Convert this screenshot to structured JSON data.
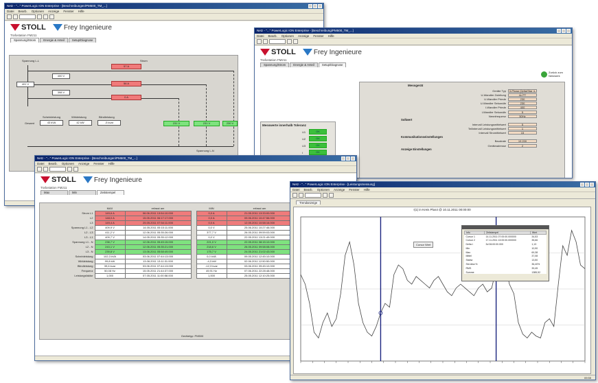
{
  "windows": {
    "w1": {
      "title": "Netz - \"...\" PowerLogic ION Enterprise - [Beschreibungen/PM500_TM_...]",
      "menu": [
        "Datei",
        "Bearb.",
        "Optionen",
        "Anzeige",
        "Fenster",
        "Hilfe"
      ]
    },
    "w2": {
      "title": "Netz - \"...\" PowerLogic ION Enterprise - [Beschreibung/PM500_TM_...]",
      "menu": [
        "Datei",
        "Bearb.",
        "Optionen",
        "Anzeige",
        "Fenster",
        "Hilfe"
      ]
    },
    "w3": {
      "title": "Netz - \"...\" PowerLogic ION Enterprise - [Beschreibungen/PM500_TM_...]",
      "menu": [
        "Datei",
        "Bearb.",
        "Optionen",
        "Anzeige",
        "Fenster",
        "Hilfe"
      ]
    },
    "w4": {
      "title": "Netz - \"...\" PowerLogic ION Enterprise - [Leistungsmessung]",
      "menu": [
        "Datei",
        "Bearb.",
        "Optionen",
        "Anzeige",
        "Fenster",
        "Hilfe"
      ]
    }
  },
  "brand": {
    "stoll": "STOLL",
    "frey": "Frey Ingenieure"
  },
  "w1": {
    "crumb": "Trafostation FM211",
    "tabs": [
      "Spannung/Strom",
      "Energie & Anteil",
      "Setup/Diagnose"
    ],
    "labels": {
      "spannung": "Spannung L-L",
      "strom": "Strom",
      "s1": "Spannung L-N"
    },
    "values": {
      "u1": "400 V",
      "u2": "401 V",
      "u3": "398 V",
      "i1": "57 A",
      "i2": "56 A",
      "i3": "0 A",
      "ln1": "231 V",
      "ln2": "231 V",
      "ln3": "230 V"
    },
    "bottom": {
      "a": "Scheinleistung",
      "b": "Wirkleistung",
      "c": "Blindleistung",
      "va": "43 kVA",
      "vb": "42 kW",
      "vc": "-5 kvar",
      "label": "Gesamt"
    },
    "status": "09:55"
  },
  "w2": {
    "crumb": "Trafostation FM211",
    "tabs": [
      "Spannung/Strom",
      "Energie & Anteil",
      "Setup/Diagnose"
    ],
    "link": "Zurück zum Netzwerk",
    "section": "Messgerät",
    "rows": [
      {
        "k": "Geräte Typ",
        "v": "3-Phase Delta/Star 4-Wire"
      },
      {
        "k": "U-Wandler Zuleitung",
        "v": "4x PT"
      },
      {
        "k": "U-Wandler Primär",
        "v": "230"
      },
      {
        "k": "U-Wandler Sekundär",
        "v": "230"
      },
      {
        "k": "I-Wandler Primär",
        "v": "400"
      },
      {
        "k": "I-Wandler Sekundär",
        "v": "5"
      },
      {
        "k": "Nennfrequenz",
        "v": "50Hz"
      }
    ],
    "sub1": "Sollwert",
    "rows2": [
      {
        "k": "Intervall Leistungsmittelwert",
        "v": "5"
      },
      {
        "k": "Teilintervall Leistungsmittelwert",
        "v": "1"
      },
      {
        "k": "Intervall Stromittelwert",
        "v": "15"
      }
    ],
    "sub2": "Kommunikationseinstellungen",
    "rows3": [
      {
        "k": "Baudrate",
        "v": "19 200"
      },
      {
        "k": "Geräteadresse",
        "v": "2"
      }
    ],
    "sub3": "Anzeige Einstellungen",
    "toleranz_title": "Messwerte innerhalb Toleranz",
    "toleranz": [
      {
        "k": "U1",
        "v": "OK"
      },
      {
        "k": "U2",
        "v": "OK"
      },
      {
        "k": "U3",
        "v": "OK"
      },
      {
        "k": "I",
        "v": "OK"
      }
    ]
  },
  "w3": {
    "crumb": "Trafostation FM211",
    "tabs": [
      "Max",
      "Min",
      "Zeitstempel"
    ],
    "headers": {
      "max": "MAX",
      "min": "MIN",
      "erfasst1": "erfasst am",
      "erfasst2": "erfasst am"
    },
    "groups": [
      {
        "label": "Strom L1",
        "max": "149,6 A",
        "t1": "06.06.2011 13:54:10.000",
        "min": "0,0 A",
        "t2": "21.05.2011 13:33:00.000",
        "color": "r"
      },
      {
        "label": "L2",
        "max": "148,0 A",
        "t1": "15.05.2011 06:17:17.000",
        "min": "0,0 A",
        "t2": "09.06.2011 10:47:56.000",
        "color": "r"
      },
      {
        "label": "L3",
        "max": "149,4 A",
        "t1": "25.05.2011 07:54:11.000",
        "min": "0,0 A",
        "t2": "12.05.2011 10:58:16.000",
        "color": "r"
      },
      {
        "label": "Spannung L1 - L2",
        "max": "409,9 V",
        "t1": "14.05.2011 05:15:11.000",
        "min": "0,0 V",
        "t2": "25.06.2011 10:27:46.000",
        "color": "w"
      },
      {
        "label": "L2 - L3",
        "max": "411,2 V",
        "t1": "12.06.2011 05:35:26.000",
        "min": "377,7 V",
        "t2": "26.05.2011 09:59:03.000",
        "color": "w"
      },
      {
        "label": "L3 - L1",
        "max": "409,7 V",
        "t1": "14.05.2011 05:35:12.000",
        "min": "0,0 V",
        "t2": "22.05.2011 13:21:49.000",
        "color": "w"
      },
      {
        "label": "Spannung L1 - N",
        "max": "238,7 V",
        "t1": "12.06.2011 05:45:15.000",
        "min": "221,0 V",
        "t2": "22.05.2011 08:15:10.000",
        "color": "g"
      },
      {
        "label": "L2 - N",
        "max": "243,1 V",
        "t1": "12.06.2011 05:35:21.000",
        "min": "218,6 V",
        "t2": "26.05.2011 09:58:08.000",
        "color": "g"
      },
      {
        "label": "L3 - N",
        "max": "239,8 V",
        "t1": "13.06.2011 05:58:49.000",
        "min": "175,7 V",
        "t2": "24.05.2011 21:02:43.000",
        "color": "g"
      },
      {
        "label": "Scheinleistung",
        "max": "102,3 kVA",
        "t1": "03.06.2011 07:44:13.000",
        "min": "0,0 kVA",
        "t2": "09.05.2011 12:45:10.000",
        "color": "w"
      },
      {
        "label": "Wirkleistung",
        "max": "99,8 kW",
        "t1": "13.06.2011 13:11:31.000",
        "min": "-4,3 kW",
        "t2": "02.06.2011 12:50:50.000",
        "color": "w"
      },
      {
        "label": "Blindleistung",
        "max": "39,6 kvar",
        "t1": "03.06.2011 07:44:13.000",
        "min": "-12,3 kvar",
        "t2": "03.06.2011 09:45:10.000",
        "color": "w"
      },
      {
        "label": "Frequenz",
        "max": "50,08 Hz",
        "t1": "15.05.2011 21:44:37.000",
        "min": "49,91 Hz",
        "t2": "07.06.2011 22:28:48.000",
        "color": "w"
      },
      {
        "label": "Leistungsfaktor",
        "max": "1,000",
        "t1": "07.05.2011 11:00:58.000",
        "min": "1,000",
        "t2": "25.05.2011 12:10:25.000",
        "color": "w"
      }
    ],
    "footer": "Gerätetyp: PM500",
    "status": "09:55"
  },
  "w4": {
    "tab": "Trendanzeige",
    "chart_title": "I(1) in Kreis Plus4 @ 10.11.2011 00:00:00",
    "tooltip_label": "Cursor Wert",
    "table_headers": [
      "Info",
      "Zeitstempel",
      "Wert"
    ],
    "table_rows": [
      [
        "Cursor 1",
        "14.11.2011 07:00:00.000000",
        "34,53"
      ],
      [
        "Cursor 2",
        "17.11.2011 13:00:00.000000",
        "35,66"
      ],
      [
        "Delta t",
        "3d 06:00:00.000",
        "1,13"
      ],
      [
        "Min",
        "",
        "10,90"
      ],
      [
        "Max",
        "",
        "69,38"
      ],
      [
        "Mittel",
        "",
        "37,08"
      ],
      [
        "Stabw",
        "",
        "13,50"
      ],
      [
        "Std.Abw.%",
        "",
        "36,40%"
      ],
      [
        "RMS",
        "",
        "39,45"
      ],
      [
        "Summe",
        "",
        "1385,52"
      ]
    ],
    "status": "09:55"
  },
  "chart_data": {
    "type": "line",
    "title": "I(1) in Kreis Plus4 @ 10.11.2011 00:00:00",
    "x": [
      0,
      1,
      2,
      3,
      4,
      5,
      6,
      7,
      8,
      9,
      10,
      11,
      12,
      13,
      14,
      15,
      16,
      17,
      18,
      19,
      20,
      21,
      22,
      23,
      24,
      25,
      26,
      27,
      28,
      29,
      30,
      31,
      32,
      33,
      34,
      35,
      36,
      37,
      38,
      39,
      40,
      41,
      42,
      43,
      44,
      45,
      46,
      47,
      48,
      49,
      50,
      51,
      52,
      53,
      54,
      55,
      56,
      57,
      58,
      59,
      60,
      61,
      62,
      63,
      64
    ],
    "series": [
      {
        "values": [
          45,
          40,
          30,
          15,
          12,
          20,
          25,
          18,
          22,
          35,
          55,
          62,
          50,
          30,
          20,
          15,
          13,
          18,
          25,
          30,
          28,
          45,
          50,
          48,
          42,
          40,
          44,
          42,
          40,
          38,
          42,
          44,
          40,
          36,
          34,
          38,
          40,
          38,
          36,
          34,
          38,
          40,
          36,
          38,
          48,
          52,
          50,
          40,
          35,
          20,
          14,
          12,
          15,
          13,
          12,
          20,
          22,
          18,
          40,
          60,
          55,
          68,
          62,
          50,
          48
        ]
      }
    ],
    "ylim": [
      0,
      75
    ],
    "cursors": [
      18,
      44
    ]
  }
}
